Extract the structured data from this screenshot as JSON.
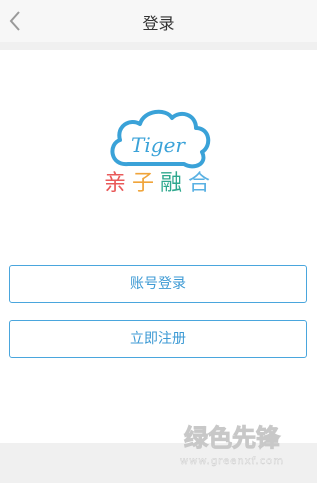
{
  "nav": {
    "title": "登录",
    "back_icon": "chevron-left-icon"
  },
  "logo": {
    "tiger_text": "Tiger",
    "brand_text": [
      "亲",
      "子",
      "融",
      "合"
    ],
    "brand_colors": [
      "#e95a5a",
      "#f0a43a",
      "#2fa88e",
      "#5ab1e3"
    ],
    "cloud_color": "#3aa2d8"
  },
  "buttons": {
    "login_label": "账号登录",
    "register_label": "立即注册",
    "accent": "#3d9ad4"
  },
  "watermark": {
    "brand": "绿色先锋",
    "url": "www.greenxf.com"
  }
}
